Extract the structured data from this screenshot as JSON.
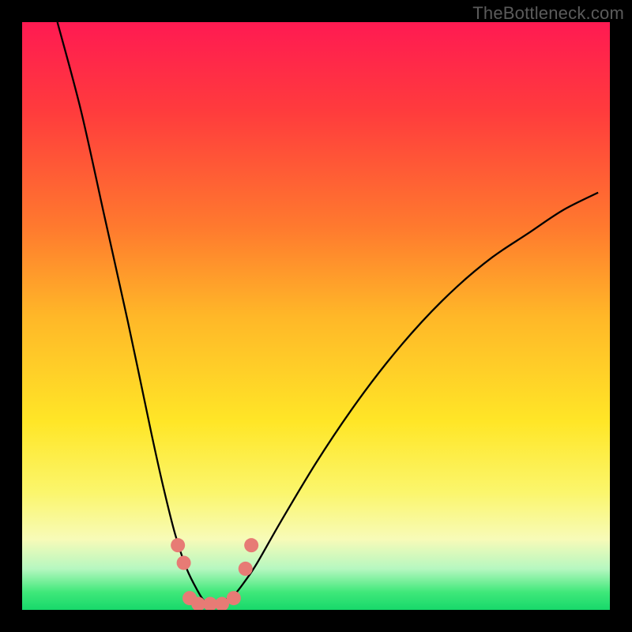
{
  "attribution": "TheBottleneck.com",
  "chart_data": {
    "type": "line",
    "title": "",
    "xlabel": "",
    "ylabel": "",
    "xlim": [
      0,
      100
    ],
    "ylim": [
      0,
      100
    ],
    "grid": false,
    "legend": false,
    "annotations": [],
    "series": [
      {
        "name": "curve",
        "color": "#000000",
        "x": [
          6,
          10,
          14,
          18,
          22,
          24,
          26,
          28,
          30,
          31,
          32,
          33,
          34,
          36,
          38,
          40,
          44,
          50,
          56,
          62,
          68,
          74,
          80,
          86,
          92,
          98
        ],
        "y": [
          100,
          85,
          67,
          49,
          30,
          21,
          13,
          7,
          3,
          1.5,
          1,
          1,
          1.5,
          2.5,
          5,
          8,
          15,
          25,
          34,
          42,
          49,
          55,
          60,
          64,
          68,
          71
        ]
      },
      {
        "name": "markers",
        "color": "#e77b75",
        "marker": "circle",
        "x": [
          26.5,
          27.5,
          28.5,
          30,
          32,
          34,
          36,
          38,
          39
        ],
        "y": [
          11,
          8,
          2,
          1,
          1,
          1,
          2,
          7,
          11
        ]
      }
    ]
  }
}
